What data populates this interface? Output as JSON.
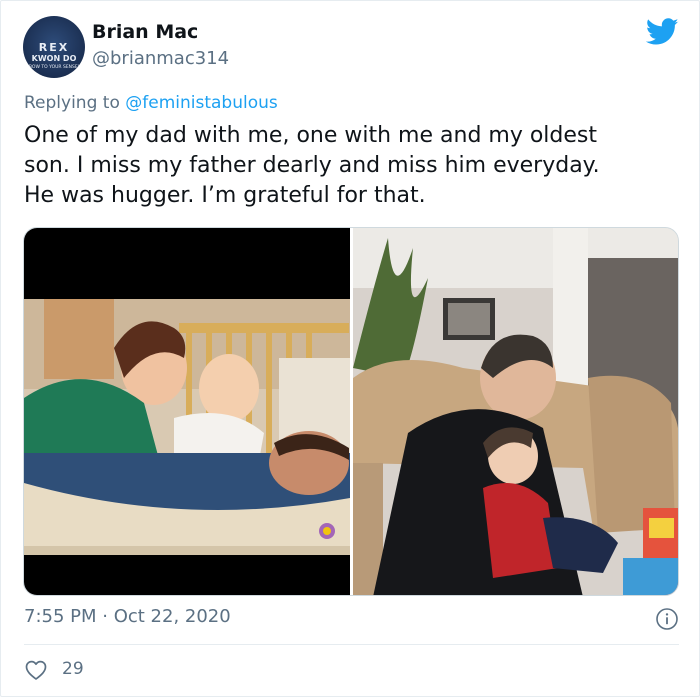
{
  "author": {
    "name": "Brian Mac",
    "handle": "@brianmac314",
    "avatar_text": [
      "REX",
      "KWON DO",
      "BOW TO YOUR SENSEI"
    ]
  },
  "reply": {
    "prefix": "Replying to",
    "mention": "@feministabulous"
  },
  "tweet": {
    "lines": [
      "One of my dad with me, one with me and my oldest",
      "son. I miss my father dearly and miss him everyday.",
      "He was hugger. I’m grateful for that."
    ]
  },
  "media": {
    "images": [
      "old-family-photo",
      "father-and-son-photo"
    ]
  },
  "meta": {
    "timestamp": "7:55 PM · Oct 22, 2020",
    "likes": "29"
  },
  "colors": {
    "accent": "#1da1f2",
    "secondary_text": "#5b7083",
    "divider": "#e6ecf0"
  },
  "icons": [
    "twitter-bird-icon",
    "info-icon",
    "heart-icon"
  ]
}
